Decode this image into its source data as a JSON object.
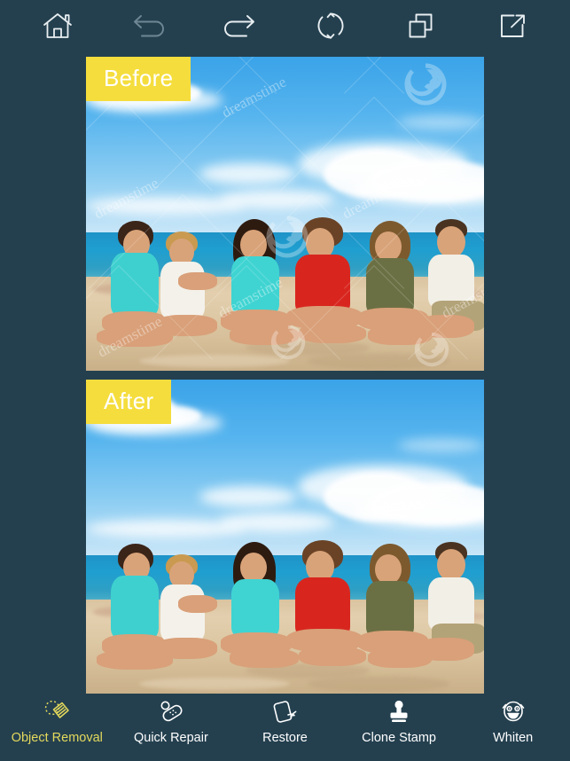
{
  "app": {
    "background_color": "#24404f",
    "accent_color": "#e4d95c",
    "chip_color": "#f5dd3d"
  },
  "topbar": {
    "buttons": [
      {
        "name": "home-icon",
        "label": "Home",
        "state": "enabled"
      },
      {
        "name": "undo-icon",
        "label": "Undo",
        "state": "disabled"
      },
      {
        "name": "redo-icon",
        "label": "Redo",
        "state": "enabled"
      },
      {
        "name": "reset-icon",
        "label": "Reset",
        "state": "enabled"
      },
      {
        "name": "compare-icon",
        "label": "Compare",
        "state": "enabled"
      },
      {
        "name": "share-icon",
        "label": "Share",
        "state": "enabled"
      }
    ]
  },
  "preview": {
    "before": {
      "chip_label": "Before",
      "description": "Six friends sitting on a sandy beach by the sea under a blue sky with clouds",
      "watermark_text": "dreamstime",
      "has_watermark": true
    },
    "after": {
      "chip_label": "After",
      "description": "Same beach photo with the watermarks removed",
      "watermark_text": "",
      "has_watermark": false
    }
  },
  "bottombar": {
    "tools": [
      {
        "icon": "object-removal-icon",
        "label": "Object Removal",
        "active": true
      },
      {
        "icon": "quick-repair-icon",
        "label": "Quick Repair",
        "active": false
      },
      {
        "icon": "restore-icon",
        "label": "Restore",
        "active": false
      },
      {
        "icon": "clone-stamp-icon",
        "label": "Clone Stamp",
        "active": false
      },
      {
        "icon": "whiten-icon",
        "label": "Whiten",
        "active": false
      }
    ]
  }
}
